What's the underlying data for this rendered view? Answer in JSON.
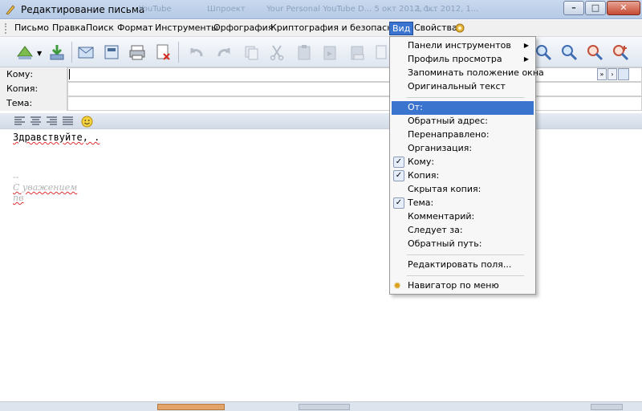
{
  "window": {
    "title": "Редактирование письма",
    "background_tabs": [
      "YouTube",
      "Шпроект",
      "Your Personal YouTube D... 5 окт 2012, 1...",
      "1 окт 2012, 1..."
    ]
  },
  "menubar": {
    "items": [
      "Письмо",
      "Правка",
      "Поиск",
      "Формат",
      "Инструменты",
      "Орфография",
      "Криптография и безопасность",
      "Вид",
      "Свойства"
    ],
    "active": "Вид"
  },
  "fields": {
    "to_label": "Кому:",
    "to_value": "",
    "cc_label": "Копия:",
    "cc_value": "",
    "subject_label": "Тема:",
    "subject_value": ""
  },
  "body": {
    "greeting": "Здравствуйте, .",
    "sig_dashes": "--",
    "sig_regards": "С уважением",
    "sig_name": "пв"
  },
  "view_menu": {
    "items": [
      {
        "label": "Панели инструментов",
        "submenu": true
      },
      {
        "label": "Профиль просмотра",
        "submenu": true
      },
      {
        "label": "Запоминать положение окна"
      },
      {
        "label": "Оригинальный текст"
      },
      {
        "label": "От:",
        "highlighted": true
      },
      {
        "label": "Обратный адрес:"
      },
      {
        "label": "Перенаправлено:"
      },
      {
        "label": "Организация:"
      },
      {
        "label": "Кому:",
        "checked": true
      },
      {
        "label": "Копия:",
        "checked": true
      },
      {
        "label": "Скрытая копия:"
      },
      {
        "label": "Тема:",
        "checked": true
      },
      {
        "label": "Комментарий:"
      },
      {
        "label": "Следует за:"
      },
      {
        "label": "Обратный путь:"
      },
      {
        "label": "Редактировать поля..."
      },
      {
        "label": "Навигатор по меню"
      }
    ],
    "checkmark": "✓",
    "submenu_arrow": "▶"
  },
  "colors": {
    "menu_highlight": "#3b74cf",
    "window_chrome": "#b6cae6",
    "signature_text": "#b4b4b4"
  }
}
